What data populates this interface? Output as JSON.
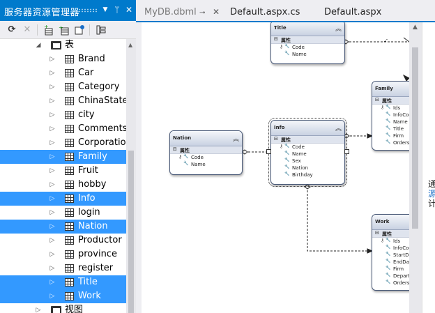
{
  "explorer": {
    "title": "服务器资源管理器",
    "controls": {
      "dropdown": "▼",
      "pin": "ᛘ",
      "close": "✕"
    },
    "toolbar_icons": [
      "refresh-icon",
      "stop-icon",
      "connect-database-icon",
      "connect-server-icon",
      "sharepoint-icon",
      "properties-icon"
    ],
    "tree": {
      "tables_label": "表",
      "tables": [
        {
          "label": "Brand",
          "selected": false
        },
        {
          "label": "Car",
          "selected": false
        },
        {
          "label": "Category",
          "selected": false
        },
        {
          "label": "ChinaStates",
          "selected": false
        },
        {
          "label": "city",
          "selected": false
        },
        {
          "label": "Comments",
          "selected": false
        },
        {
          "label": "Corporation",
          "selected": false
        },
        {
          "label": "Family",
          "selected": true
        },
        {
          "label": "Fruit",
          "selected": false
        },
        {
          "label": "hobby",
          "selected": false
        },
        {
          "label": "Info",
          "selected": true
        },
        {
          "label": "login",
          "selected": false
        },
        {
          "label": "Nation",
          "selected": true
        },
        {
          "label": "Productor",
          "selected": false
        },
        {
          "label": "province",
          "selected": false
        },
        {
          "label": "register",
          "selected": false
        },
        {
          "label": "Title",
          "selected": true
        },
        {
          "label": "Work",
          "selected": true
        }
      ],
      "views_label": "视图"
    }
  },
  "tabs": [
    {
      "label": "MyDB.dbml",
      "active": true
    },
    {
      "label": "Default.aspx.cs",
      "active": false
    },
    {
      "label": "Default.aspx",
      "active": false
    }
  ],
  "designer": {
    "section_label": "属性",
    "entities": [
      {
        "name": "Title",
        "props": [
          {
            "name": "Code",
            "key": true
          },
          {
            "name": "Name",
            "key": false
          }
        ]
      },
      {
        "name": "Family",
        "props": [
          {
            "name": "Ids",
            "key": true
          },
          {
            "name": "InfoCode",
            "key": false
          },
          {
            "name": "Name",
            "key": false
          },
          {
            "name": "Title",
            "key": false
          },
          {
            "name": "Firm",
            "key": false
          },
          {
            "name": "Orders",
            "key": false
          }
        ]
      },
      {
        "name": "Nation",
        "props": [
          {
            "name": "Code",
            "key": true
          },
          {
            "name": "Name",
            "key": false
          }
        ]
      },
      {
        "name": "Info",
        "props": [
          {
            "name": "Code",
            "key": true
          },
          {
            "name": "Name",
            "key": false
          },
          {
            "name": "Sex",
            "key": false
          },
          {
            "name": "Nation",
            "key": false
          },
          {
            "name": "Birthday",
            "key": false
          }
        ]
      },
      {
        "name": "Work",
        "props": [
          {
            "name": "Ids",
            "key": true
          },
          {
            "name": "InfoCode",
            "key": false
          },
          {
            "name": "StartDate",
            "key": false
          },
          {
            "name": "EndDate",
            "key": false
          },
          {
            "name": "Firm",
            "key": false
          },
          {
            "name": "Depart",
            "key": false
          },
          {
            "name": "Orders",
            "key": false
          }
        ]
      }
    ]
  },
  "properties_side_text": [
    "通",
    "源",
    "计"
  ],
  "colors": {
    "accent": "#007acc",
    "selection": "#3399ff"
  }
}
